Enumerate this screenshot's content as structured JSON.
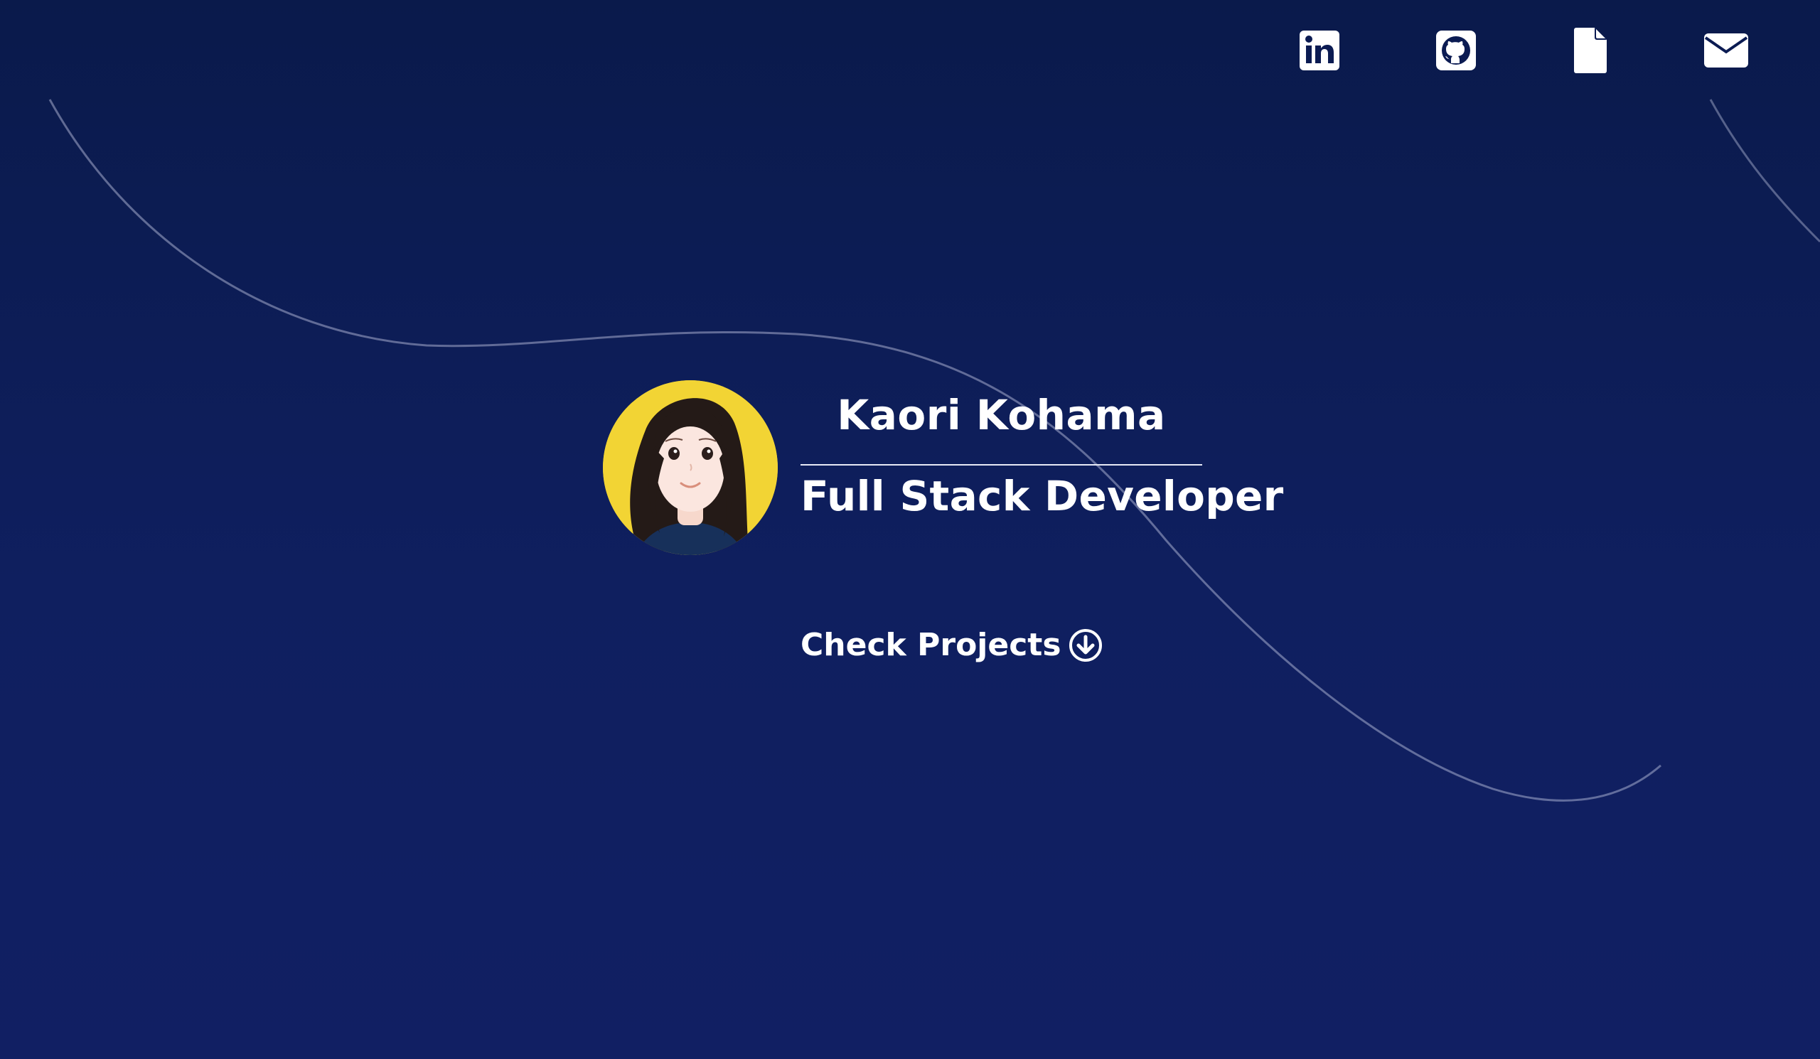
{
  "nav": {
    "items": [
      {
        "id": "linkedin",
        "icon": "linkedin-icon"
      },
      {
        "id": "github",
        "icon": "github-icon"
      },
      {
        "id": "resume",
        "icon": "document-icon"
      },
      {
        "id": "email",
        "icon": "envelope-icon"
      }
    ]
  },
  "hero": {
    "name": "Kaori Kohama",
    "role": "Full Stack Developer",
    "cta_label": "Check Projects",
    "cta_icon": "arrow-down-circle-icon",
    "avatar": "avatar-illustration"
  },
  "colors": {
    "background_top": "#0a1a4b",
    "background_bottom": "#111f63",
    "text": "#ffffff",
    "avatar_bg": "#f2d434"
  }
}
